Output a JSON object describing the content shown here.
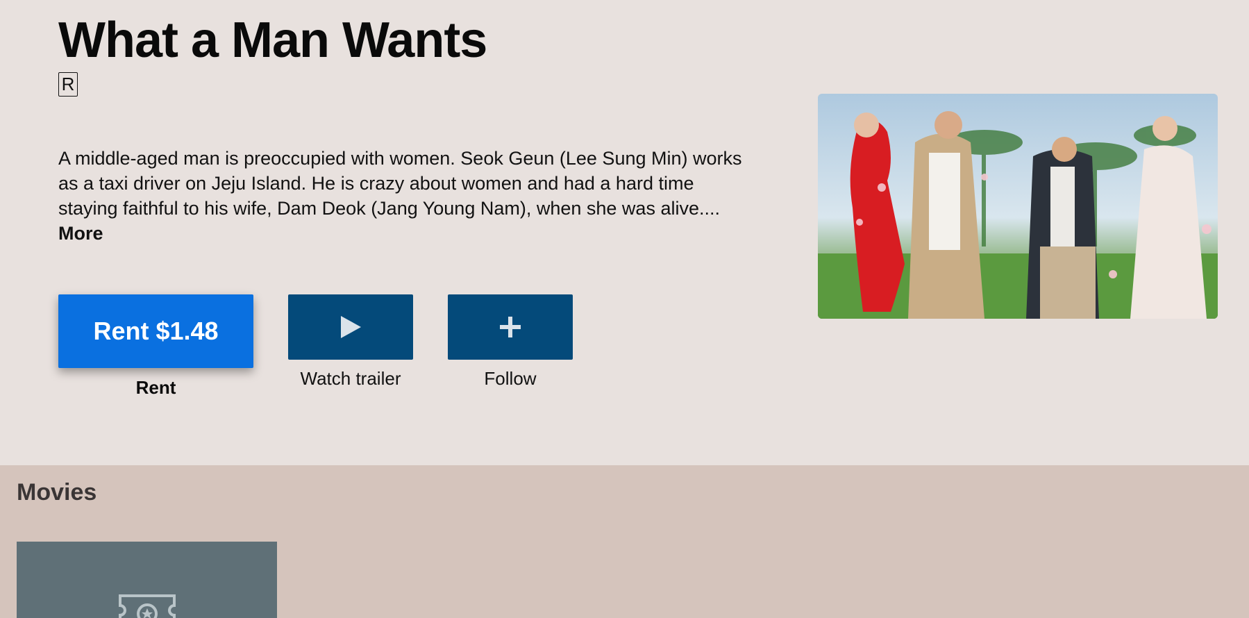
{
  "movie": {
    "title": "What a Man Wants",
    "rating": "R",
    "description": "A middle-aged man is preoccupied with women. Seok Geun (Lee Sung Min) works as a taxi driver on Jeju Island. He is crazy about women and had a hard time staying faithful to his wife, Dam Deok (Jang Young Nam), when she was alive....",
    "more_label": "More"
  },
  "actions": {
    "rent_button": "Rent $1.48",
    "rent_label": "Rent",
    "trailer_icon": "play-icon",
    "trailer_label": "Watch trailer",
    "follow_icon": "plus-icon",
    "follow_label": "Follow"
  },
  "shelf": {
    "title": "Movies",
    "items": [
      {
        "icon": "ticket-icon"
      }
    ]
  },
  "colors": {
    "background": "#e8e1de",
    "shelf_background": "#d5c4bc",
    "rent_accent": "#0a70e0",
    "secondary_button": "#044a7a",
    "placeholder_tile": "#5f7077"
  }
}
